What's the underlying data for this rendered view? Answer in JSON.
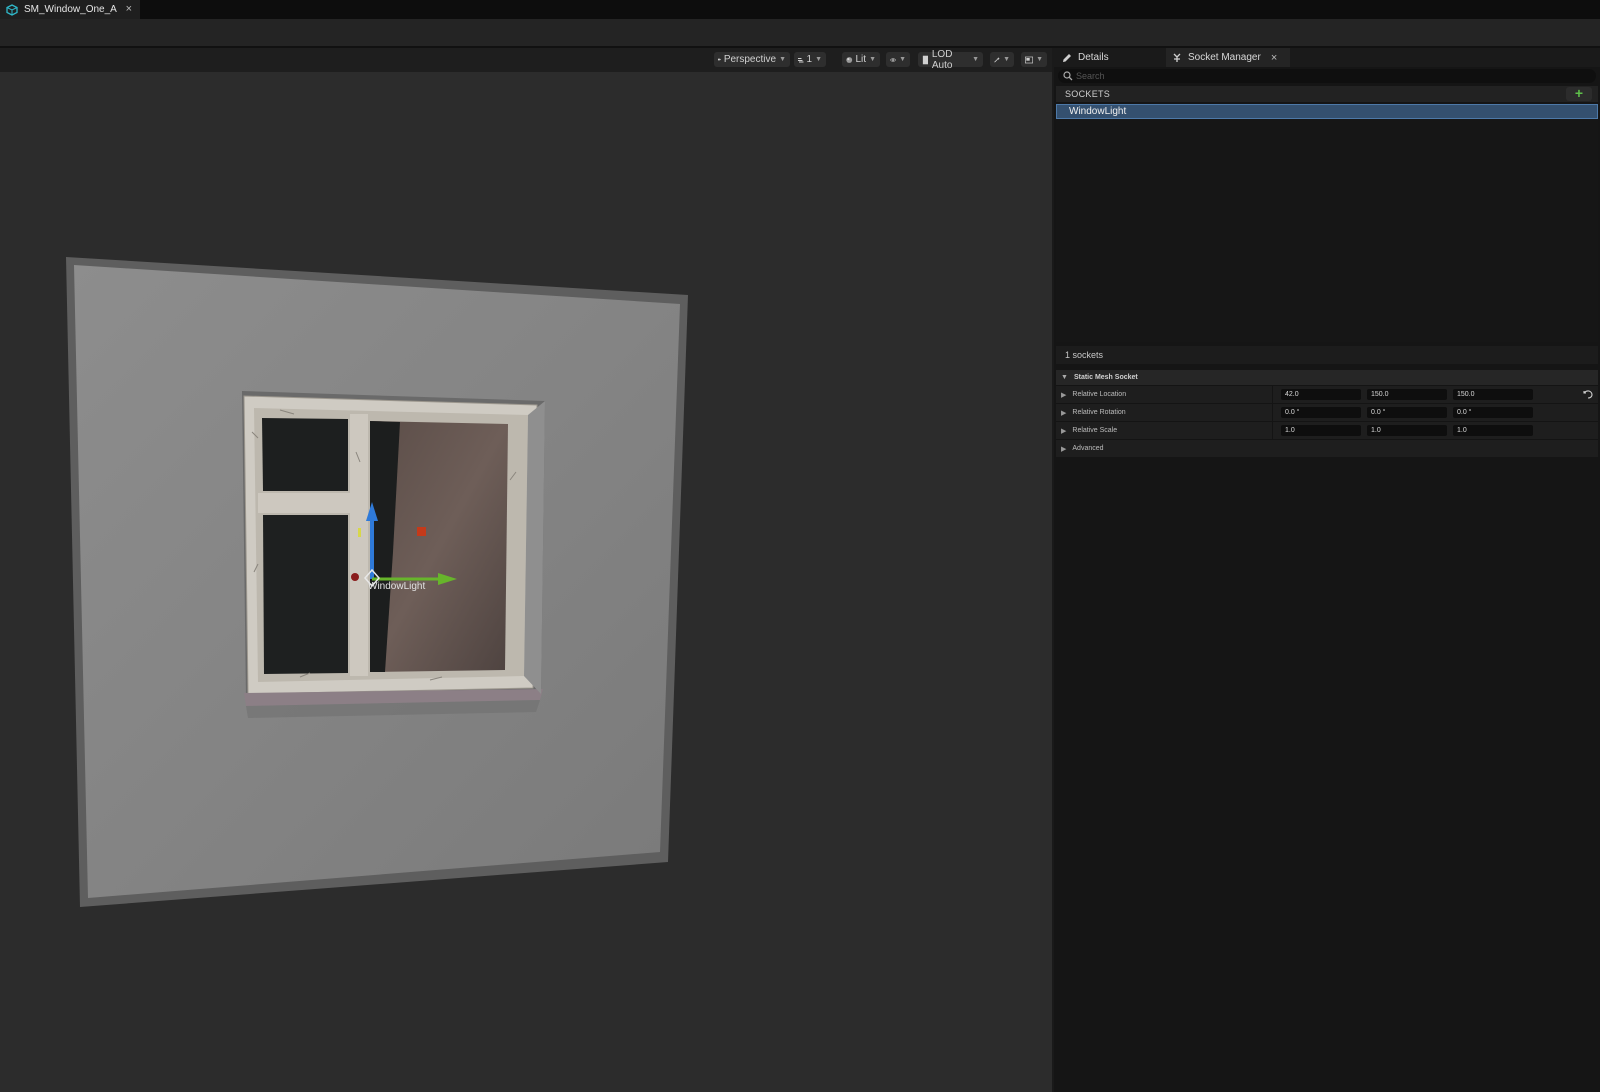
{
  "document_tab": {
    "title": "SM_Window_One_A",
    "close": "×"
  },
  "viewport": {
    "toolbar": {
      "camera_label": "Perspective",
      "layers_label": "1",
      "view_mode_label": "Lit",
      "lod_label": "LOD Auto"
    },
    "socket_label": "WindowLight"
  },
  "panel": {
    "tabs": [
      {
        "label": "Details"
      },
      {
        "label": "Socket Manager",
        "close": "×"
      }
    ],
    "search_placeholder": "Search",
    "sockets_header": "SOCKETS",
    "add_symbol": "+",
    "sockets": [
      {
        "name": "WindowLight"
      }
    ],
    "socket_count": "1 sockets",
    "category": "Static Mesh Socket",
    "properties": [
      {
        "label": "Relative Location",
        "values": [
          "42.0",
          "150.0",
          "150.0"
        ]
      },
      {
        "label": "Relative Rotation",
        "values": [
          "0.0 °",
          "0.0 °",
          "0.0 °"
        ]
      },
      {
        "label": "Relative Scale",
        "values": [
          "1.0",
          "1.0",
          "1.0"
        ]
      }
    ],
    "advanced_label": "Advanced"
  },
  "colors": {
    "accent_blue": "#34506f",
    "gizmo_x": "#c43a1a",
    "gizmo_y": "#67b52b",
    "gizmo_z": "#2f7ad9",
    "add_green": "#5ec04a"
  }
}
